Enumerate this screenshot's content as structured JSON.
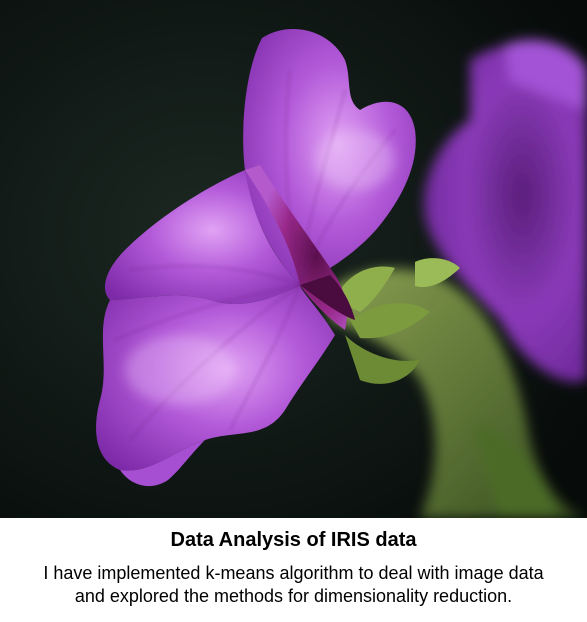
{
  "caption": {
    "title": "Data Analysis of IRIS data",
    "description_line1": "I have implemented k-means algorithm to deal with image data",
    "description_line2": "and explored the methods for dimensionality reduction."
  },
  "colors": {
    "background_dark": "#0d1512",
    "petal_purple": "#a23fd0",
    "petal_highlight": "#d38af0",
    "throat_magenta": "#7a1a6b",
    "stem_green": "#7a9a3a"
  }
}
